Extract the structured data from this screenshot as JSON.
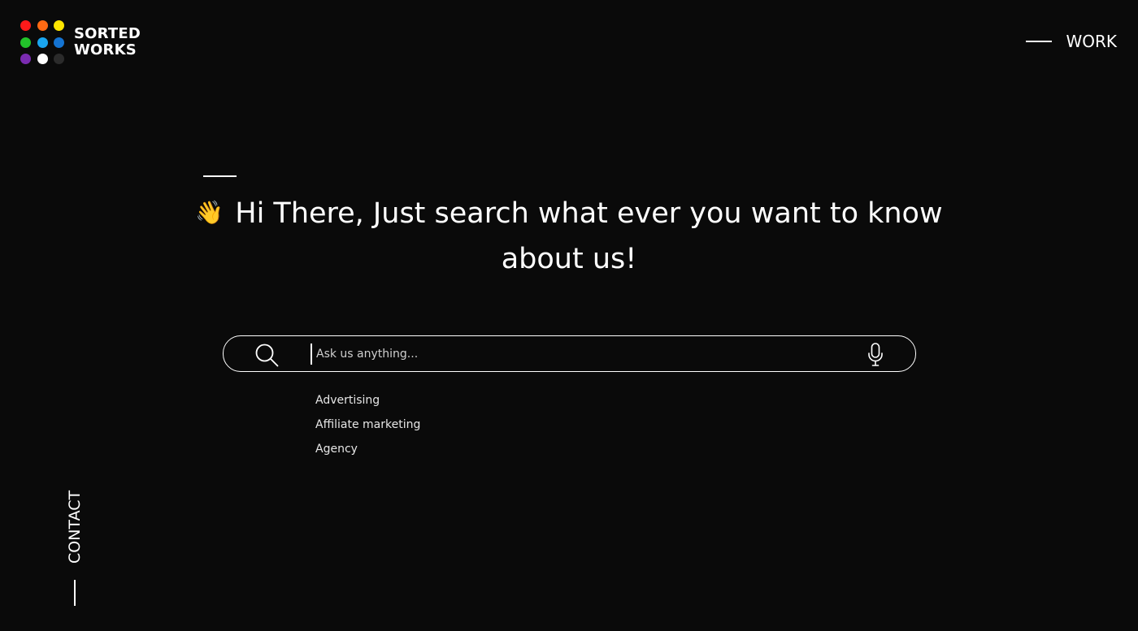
{
  "colors": {
    "background": "#0a0a0a",
    "foreground": "#ffffff",
    "wave_emoji": "#f5d000"
  },
  "logo": {
    "line1": "SORTED",
    "line2": "WORKS",
    "dot_colors": [
      "#ff1a1a",
      "#ff6a13",
      "#ffe600",
      "#22c22a",
      "#1aa6f0",
      "#1473d1",
      "#7a2bb0",
      "#ffffff",
      "#2b2b2b"
    ]
  },
  "nav": {
    "work_label": "WORK",
    "contact_label": "CONTACT"
  },
  "hero": {
    "wave_icon": "👋",
    "heading": "Hi There, Just search what ever you want to know about us!"
  },
  "search": {
    "placeholder": "Ask us anything...",
    "value": "",
    "icon": "search-icon",
    "mic_icon": "microphone-icon"
  },
  "suggestions": [
    "Advertising",
    "Affiliate marketing",
    "Agency"
  ]
}
